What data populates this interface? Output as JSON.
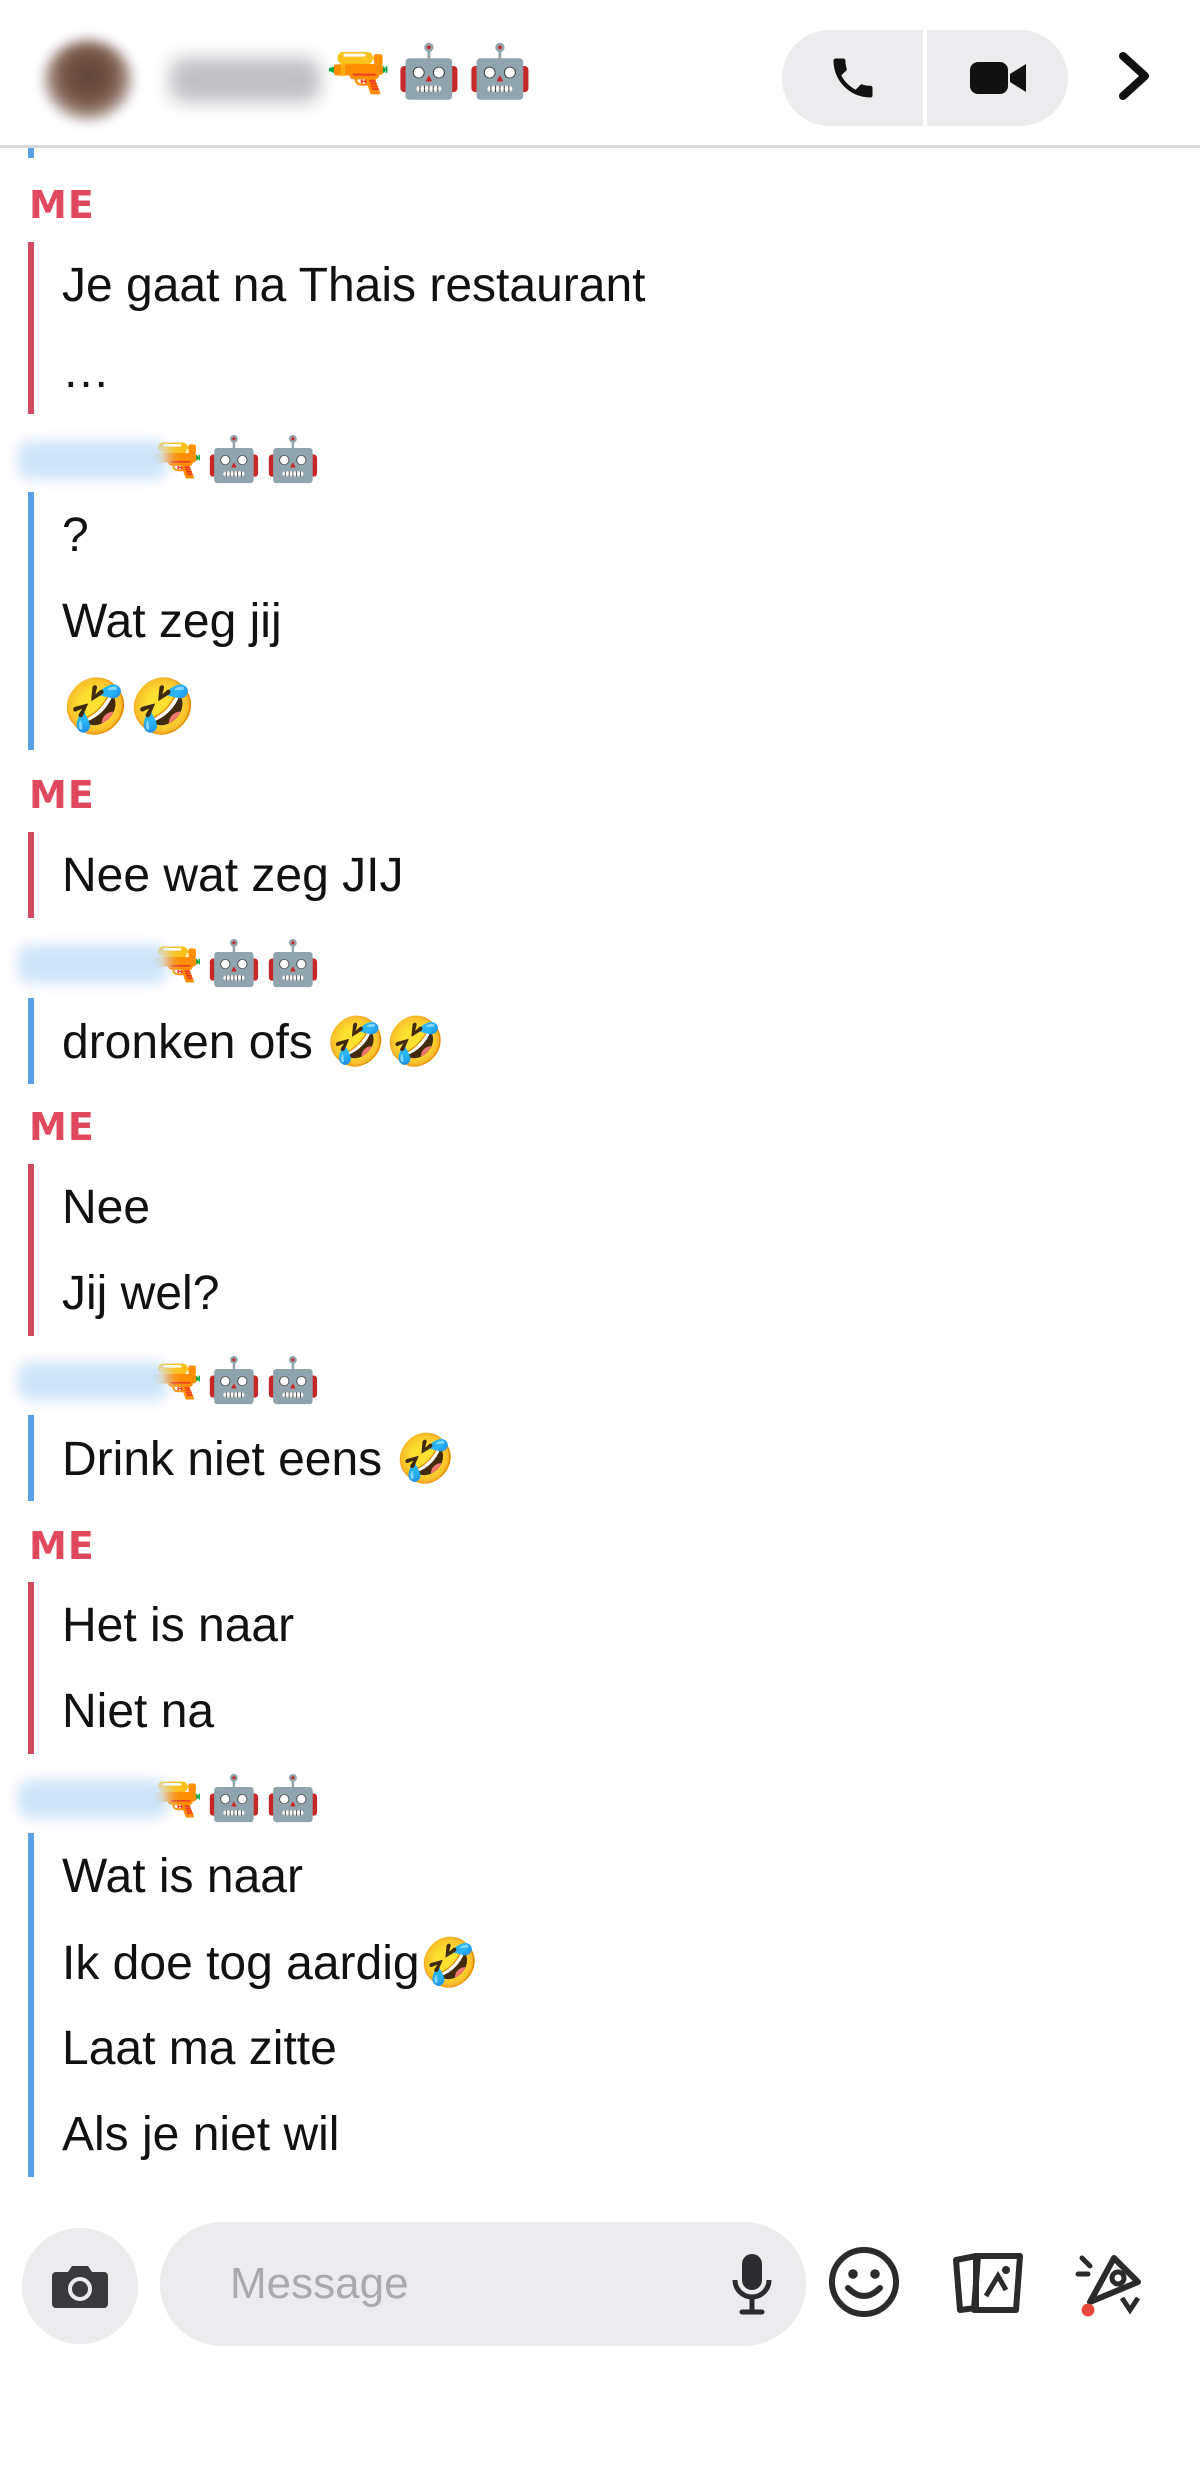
{
  "header": {
    "contact_emojis": "🔫🤖🤖",
    "call_icon": "phone-icon",
    "video_icon": "video-camera-icon",
    "more_icon": "chevron-right-icon"
  },
  "colors": {
    "me": "#e0485e",
    "me_bar": "#d24a60",
    "them_bar": "#5aa0e6",
    "pill_bg": "#ececef"
  },
  "chat": {
    "me_label": "ME",
    "other_emojis": "🔫🤖🤖",
    "groups": [
      {
        "sender": "me",
        "messages": [
          "Je gaat na Thais restaurant",
          "…"
        ]
      },
      {
        "sender": "them",
        "messages": [
          "?",
          "Wat zeg jij",
          "🤣🤣"
        ]
      },
      {
        "sender": "me",
        "messages": [
          "Nee wat zeg JIJ"
        ]
      },
      {
        "sender": "them",
        "messages": [
          "dronken ofs 🤣🤣"
        ]
      },
      {
        "sender": "me",
        "messages": [
          "Nee",
          "Jij wel?"
        ]
      },
      {
        "sender": "them",
        "messages": [
          "Drink niet eens 🤣"
        ]
      },
      {
        "sender": "me",
        "messages": [
          "Het is naar",
          "Niet na"
        ]
      },
      {
        "sender": "them",
        "messages": [
          "Wat is naar",
          "Ik doe tog aardig🤣",
          "Laat ma zitte",
          "Als je niet wil"
        ]
      }
    ]
  },
  "composer": {
    "placeholder": "Message",
    "camera_icon": "camera-icon",
    "mic_icon": "microphone-icon",
    "emoji_icon": "smiley-icon",
    "memories_icon": "memories-cards-icon",
    "sticker_icon": "rocket-sticker-icon"
  }
}
